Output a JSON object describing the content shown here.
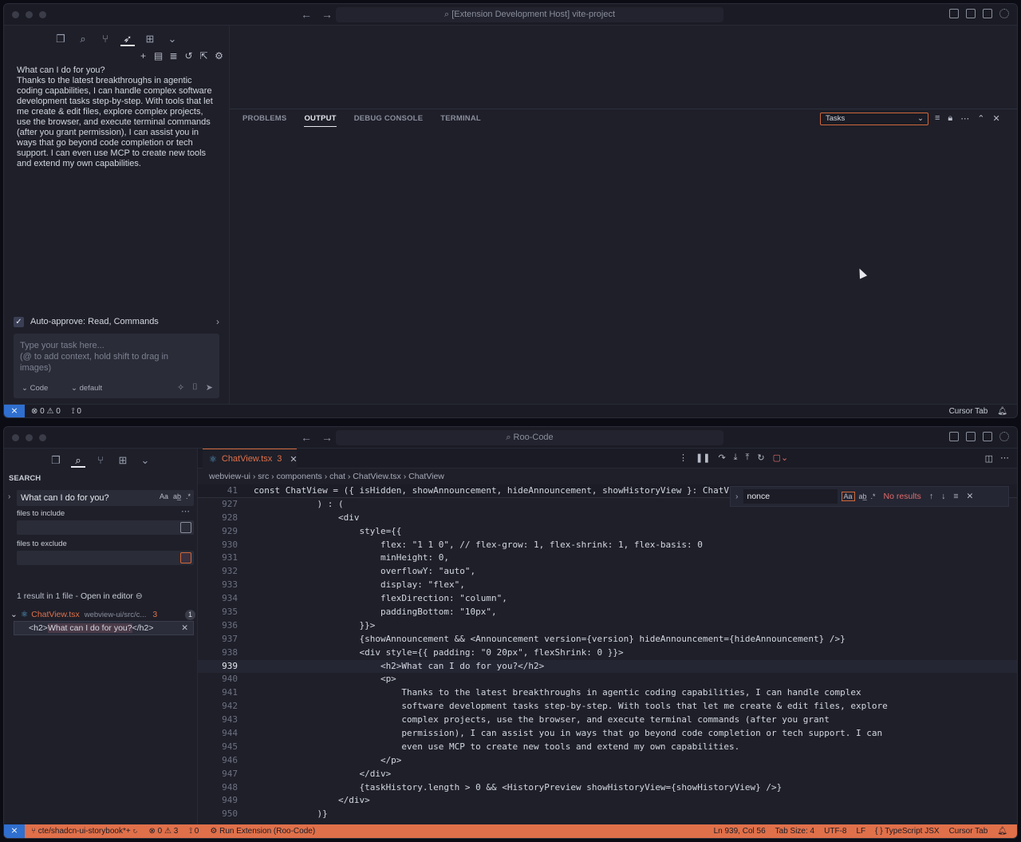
{
  "colors": {
    "accent": "#e0704a",
    "remote": "#2f6fcf",
    "background": "#1e1f29"
  },
  "window1": {
    "title": "[Extension Development Host] vite-project",
    "welcome": {
      "heading": "What can I do for you?",
      "body": "Thanks to the latest breakthroughs in agentic\ncoding capabilities, I can handle complex software\ndevelopment tasks step-by-step. With tools that let\nme create & edit files, explore complex projects,\nuse the browser, and execute terminal commands\n(after you grant permission), I can assist you in\nways that go beyond code completion or tech\nsupport. I can even use MCP to create new tools\nand extend my own capabilities."
    },
    "auto_approve": "Auto-approve: Read, Commands",
    "task_placeholder": "Type your task here...\n(@ to add context, hold shift to drag in\nimages)",
    "mode": "Code",
    "profile": "default",
    "panel_tabs": [
      "PROBLEMS",
      "OUTPUT",
      "DEBUG CONSOLE",
      "TERMINAL"
    ],
    "active_panel_tab": "OUTPUT",
    "output_channel": "Tasks",
    "status": {
      "errors": "0",
      "warnings": "0",
      "ports": "0",
      "cursor_tab": "Cursor Tab"
    }
  },
  "window2": {
    "title": "Roo-Code",
    "search": {
      "title": "SEARCH",
      "query": "What can I do for you?",
      "files_include_label": "files to include",
      "files_exclude_label": "files to exclude",
      "summary": "1 result in 1 file - ",
      "open_in_editor": "Open in editor",
      "file_name": "ChatView.tsx",
      "file_path": "webview-ui/src/c...",
      "file_count": "3",
      "file_badge": "1",
      "match_prefix": "<h2>",
      "match_hl": "What can I do for you?",
      "match_suffix": "</h2>"
    },
    "tab": {
      "label": "ChatView.tsx",
      "count": "3"
    },
    "breadcrumb": "webview-ui  ›  src  ›  components  ›  chat  ›  ChatView.tsx  ›  ChatView",
    "find": {
      "value": "nonce",
      "result": "No results"
    },
    "code_lines": [
      {
        "n": "41",
        "t": "const ChatView = ({ isHidden, showAnnouncement, hideAnnouncement, showHistoryView }: ChatV"
      },
      {
        "n": "927",
        "t": "            ) : ("
      },
      {
        "n": "928",
        "t": "                <div"
      },
      {
        "n": "929",
        "t": "                    style={{"
      },
      {
        "n": "930",
        "t": "                        flex: \"1 1 0\", // flex-grow: 1, flex-shrink: 1, flex-basis: 0"
      },
      {
        "n": "931",
        "t": "                        minHeight: 0,"
      },
      {
        "n": "932",
        "t": "                        overflowY: \"auto\","
      },
      {
        "n": "933",
        "t": "                        display: \"flex\","
      },
      {
        "n": "934",
        "t": "                        flexDirection: \"column\","
      },
      {
        "n": "935",
        "t": "                        paddingBottom: \"10px\","
      },
      {
        "n": "936",
        "t": "                    }}>"
      },
      {
        "n": "937",
        "t": "                    {showAnnouncement && <Announcement version={version} hideAnnouncement={hideAnnouncement} />}"
      },
      {
        "n": "938",
        "t": "                    <div style={{ padding: \"0 20px\", flexShrink: 0 }}>"
      },
      {
        "n": "939",
        "t": "                        <h2>What can I do for you?</h2>"
      },
      {
        "n": "940",
        "t": "                        <p>"
      },
      {
        "n": "941",
        "t": "                            Thanks to the latest breakthroughs in agentic coding capabilities, I can handle complex"
      },
      {
        "n": "942",
        "t": "                            software development tasks step-by-step. With tools that let me create & edit files, explore"
      },
      {
        "n": "943",
        "t": "                            complex projects, use the browser, and execute terminal commands (after you grant"
      },
      {
        "n": "944",
        "t": "                            permission), I can assist you in ways that go beyond code completion or tech support. I can"
      },
      {
        "n": "945",
        "t": "                            even use MCP to create new tools and extend my own capabilities."
      },
      {
        "n": "946",
        "t": "                        </p>"
      },
      {
        "n": "947",
        "t": "                    </div>"
      },
      {
        "n": "948",
        "t": "                    {taskHistory.length > 0 && <HistoryPreview showHistoryView={showHistoryView} />}"
      },
      {
        "n": "949",
        "t": "                </div>"
      },
      {
        "n": "950",
        "t": "            )}"
      }
    ],
    "status": {
      "branch": "cte/shadcn-ui-storybook*+",
      "errors": "0",
      "warnings": "3",
      "ports": "0",
      "run": "Run Extension (Roo-Code)",
      "position": "Ln 939, Col 56",
      "tab_size": "Tab Size: 4",
      "encoding": "UTF-8",
      "eol": "LF",
      "language": "TypeScript JSX",
      "cursor_tab": "Cursor Tab"
    }
  }
}
